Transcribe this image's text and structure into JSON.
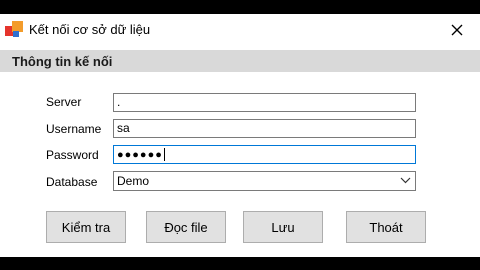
{
  "window": {
    "title": "Kết nối cơ sở dữ liệu",
    "close_glyph": "✕"
  },
  "group": {
    "title": "Thông tin kế nối"
  },
  "fields": {
    "server": {
      "label": "Server",
      "value": "."
    },
    "username": {
      "label": "Username",
      "value": "sa"
    },
    "password": {
      "label": "Password",
      "value": "●●●●●●"
    },
    "database": {
      "label": "Database",
      "value": "Demo"
    }
  },
  "buttons": {
    "check": "Kiểm tra",
    "read_file": "Đọc file",
    "save": "Lưu",
    "exit": "Thoát"
  },
  "icons": {
    "app": "database-connection-icon",
    "close": "close-icon",
    "dropdown": "chevron-down-icon"
  },
  "colors": {
    "group_bar": "#d9d9d9",
    "focus_border": "#0078d7",
    "button_face": "#e1e1e1"
  }
}
